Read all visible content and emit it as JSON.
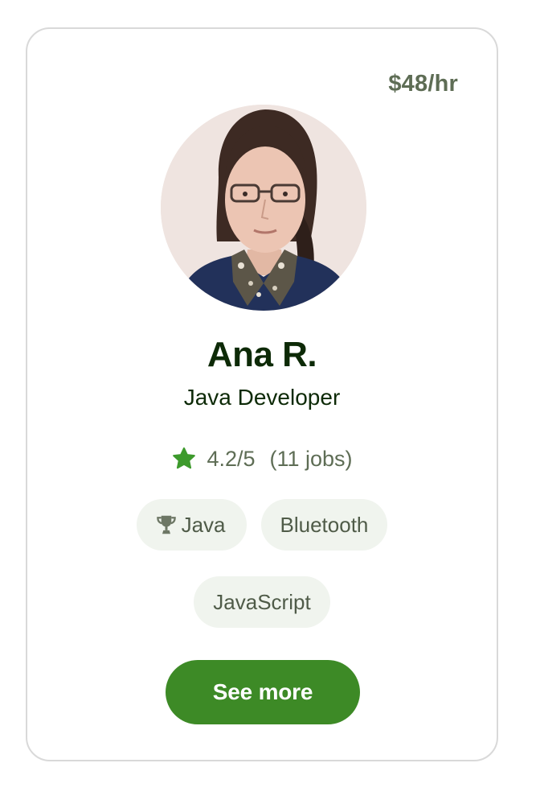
{
  "profile": {
    "rate": "$48/hr",
    "name": "Ana R.",
    "title": "Java Developer",
    "avatar_icon": "profile-photo",
    "rating": "4.2/5",
    "jobs": "(11 jobs)",
    "star_color": "#3d9a2c"
  },
  "skills": [
    {
      "label": "Java",
      "icon": "trophy-icon"
    },
    {
      "label": "Bluetooth"
    },
    {
      "label": "JavaScript"
    }
  ],
  "actions": {
    "see_more_label": "See more"
  },
  "colors": {
    "accent": "#3d8a26",
    "chip_bg": "#f0f4ee",
    "text_dark": "#0d2a07",
    "text_muted": "#5e6d55"
  }
}
